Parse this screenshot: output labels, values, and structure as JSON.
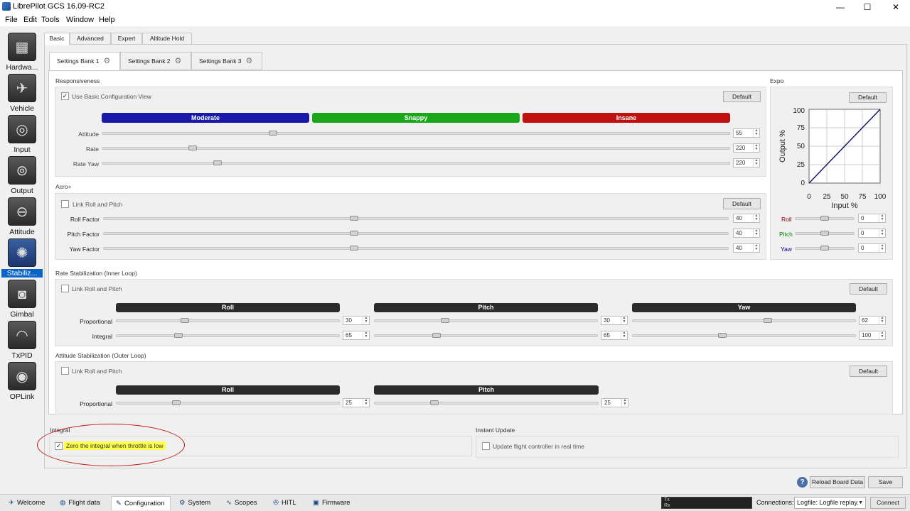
{
  "window": {
    "title": "LibrePilot GCS 16.09-RC2",
    "minimize": "—",
    "maximize": "☐",
    "close": "✕"
  },
  "menu": {
    "items": [
      "File",
      "Edit",
      "Tools",
      "Window",
      "Help"
    ]
  },
  "sidebar": {
    "items": [
      {
        "label": "Hardwa...",
        "icon": "chip-icon"
      },
      {
        "label": "Vehicle",
        "icon": "plane-icon"
      },
      {
        "label": "Input",
        "icon": "transmitter-icon"
      },
      {
        "label": "Output",
        "icon": "motor-icon"
      },
      {
        "label": "Attitude",
        "icon": "level-icon"
      },
      {
        "label": "Stabiliz...",
        "icon": "gyro-icon",
        "active": true
      },
      {
        "label": "Gimbal",
        "icon": "camera-icon"
      },
      {
        "label": "TxPID",
        "icon": "meter-icon"
      },
      {
        "label": "OPLink",
        "icon": "antenna-icon"
      }
    ]
  },
  "tabs": [
    "Basic",
    "Advanced",
    "Expert",
    "Altitude Hold"
  ],
  "banks": [
    "Settings Bank 1",
    "Settings Bank 2",
    "Settings Bank 3"
  ],
  "responsiveness": {
    "title": "Responsiveness",
    "basic_view_label": "Use Basic Configuration View",
    "basic_view_checked": true,
    "default_label": "Default",
    "bars": [
      "Moderate",
      "Snappy",
      "Insane"
    ],
    "bar_colors": [
      "#1a1aa8",
      "#1aa81a",
      "#c01010"
    ],
    "rows": [
      {
        "label": "Attitude",
        "value": "55",
        "frac": 0.27
      },
      {
        "label": "Rate",
        "value": "220",
        "frac": 0.14
      },
      {
        "label": "Rate Yaw",
        "value": "220",
        "frac": 0.18
      }
    ]
  },
  "acro": {
    "title": "Acro+",
    "link_label": "Link Roll and Pitch",
    "default_label": "Default",
    "rows": [
      {
        "label": "Roll Factor",
        "value": "40",
        "frac": 0.4
      },
      {
        "label": "Pitch Factor",
        "value": "40",
        "frac": 0.4
      },
      {
        "label": "Yaw Factor",
        "value": "40",
        "frac": 0.4
      }
    ]
  },
  "expo": {
    "title": "Expo",
    "default_label": "Default",
    "ylabel": "Output %",
    "xlabel": "Input %",
    "ticks": [
      "0",
      "25",
      "50",
      "75",
      "100"
    ],
    "rows": [
      {
        "label": "Roll",
        "value": "0",
        "color": "#8b0000"
      },
      {
        "label": "Pitch",
        "value": "0",
        "color": "#008000"
      },
      {
        "label": "Yaw",
        "value": "0",
        "color": "#000080"
      }
    ]
  },
  "rate_stab": {
    "title": "Rate Stabilization (Inner Loop)",
    "link_label": "Link Roll and Pitch",
    "default_label": "Default",
    "headers": [
      "Roll",
      "Pitch",
      "Yaw"
    ],
    "rows": [
      {
        "label": "Proportional",
        "values": [
          "30",
          "30",
          "62"
        ],
        "fracs": [
          0.3,
          0.31,
          0.61
        ]
      },
      {
        "label": "Integral",
        "values": [
          "65",
          "65",
          "100"
        ],
        "fracs": [
          0.27,
          0.27,
          0.4
        ]
      }
    ]
  },
  "att_stab": {
    "title": "Attitude Stabilization (Outer Loop)",
    "link_label": "Link Roll and Pitch",
    "default_label": "Default",
    "headers": [
      "Roll",
      "Pitch"
    ],
    "rows": [
      {
        "label": "Proportional",
        "values": [
          "25",
          "25"
        ],
        "fracs": [
          0.26,
          0.26
        ]
      }
    ]
  },
  "integral": {
    "title": "Integral",
    "label": "Zero the integral when throttle is low",
    "checked": true
  },
  "instant": {
    "title": "Instant Update",
    "label": "Update flight controller in real time",
    "checked": false
  },
  "footer": {
    "reload_label": "Reload Board Data",
    "save_label": "Save",
    "help": "?"
  },
  "bottom_tabs": [
    {
      "label": "Welcome",
      "icon": "✈"
    },
    {
      "label": "Flight data",
      "icon": "◍"
    },
    {
      "label": "Configuration",
      "icon": "✎",
      "active": true
    },
    {
      "label": "System",
      "icon": "⚙"
    },
    {
      "label": "Scopes",
      "icon": "∿"
    },
    {
      "label": "HITL",
      "icon": "✇"
    },
    {
      "label": "Firmware",
      "icon": "▣"
    }
  ],
  "status": {
    "tx": "Tx",
    "rx": "Rx",
    "connections_label": "Connections:",
    "connections_value": "Logfile: Logfile replay.",
    "connect_label": "Connect"
  }
}
